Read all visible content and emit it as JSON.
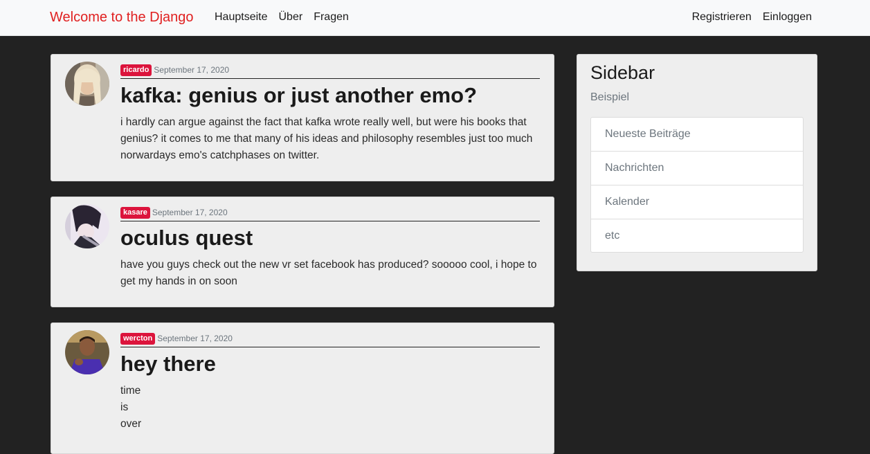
{
  "navbar": {
    "brand": "Welcome to the Django",
    "left_links": [
      "Hauptseite",
      "Über",
      "Fragen"
    ],
    "right_links": [
      "Registrieren",
      "Einloggen"
    ]
  },
  "posts": [
    {
      "author": "ricardo",
      "date": "September 17, 2020",
      "title": "kafka: genius or just another emo?",
      "content": [
        "i hardly can argue against the fact that kafka wrote really well, but were his books that genius? it comes to me that many of his ideas and philosophy resembles just too much norwardays emo's catchphases on twitter."
      ]
    },
    {
      "author": "kasare",
      "date": "September 17, 2020",
      "title": "oculus quest",
      "content": [
        "have you guys check out the new vr set facebook has produced? sooooo cool, i hope to get my hands in on soon"
      ]
    },
    {
      "author": "wercton",
      "date": "September 17, 2020",
      "title": "hey there",
      "content": [
        "time",
        "is",
        "over"
      ]
    }
  ],
  "sidebar": {
    "title": "Sidebar",
    "subtitle": "Beispiel",
    "items": [
      "Neueste Beiträge",
      "Nachrichten",
      "Kalender",
      "etc"
    ]
  },
  "colors": {
    "brand": "#e02020",
    "badge": "#dc143c",
    "page_background": "#222222",
    "card_background": "#eeeeee"
  }
}
